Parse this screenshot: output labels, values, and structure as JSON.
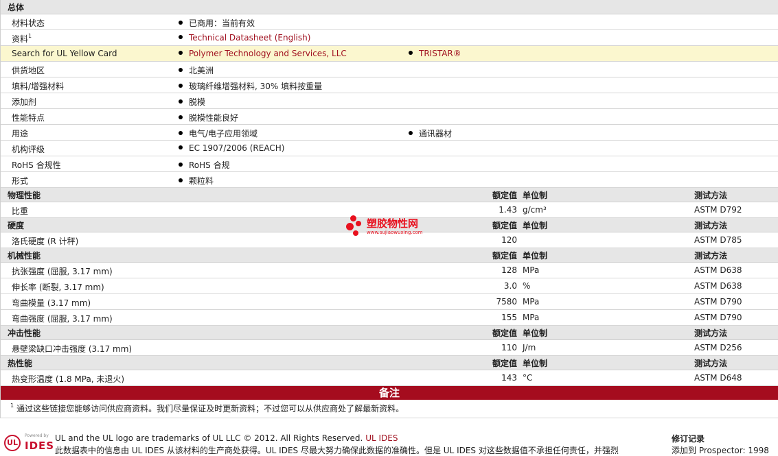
{
  "general": {
    "title": "总体",
    "rows": [
      {
        "label": "材料状态",
        "items": [
          "已商用：当前有效"
        ]
      },
      {
        "label": "资料",
        "sup": "1",
        "items": [
          "Technical Datasheet (English)"
        ],
        "link": true
      },
      {
        "label": "Search for UL Yellow Card",
        "items": [
          "Polymer Technology and Services, LLC",
          "TRISTAR®"
        ],
        "link": true,
        "highlight": true
      },
      {
        "label": "供货地区",
        "items": [
          "北美洲"
        ]
      },
      {
        "label": "填料/增强材料",
        "items": [
          "玻璃纤维增强材料, 30% 填料按重量"
        ]
      },
      {
        "label": "添加剂",
        "items": [
          "脱模"
        ]
      },
      {
        "label": "性能特点",
        "items": [
          "脱模性能良好"
        ]
      },
      {
        "label": "用途",
        "items": [
          "电气/电子应用领域",
          "通讯器材"
        ]
      },
      {
        "label": "机构评级",
        "items": [
          "EC 1907/2006 (REACH)"
        ]
      },
      {
        "label": "RoHS 合规性",
        "items": [
          "RoHS 合规"
        ]
      },
      {
        "label": "形式",
        "items": [
          "颗粒料"
        ]
      }
    ]
  },
  "col_headers": {
    "value": "额定值",
    "unit": "单位制",
    "method": "测试方法"
  },
  "sections": [
    {
      "title": "物理性能",
      "rows": [
        {
          "label": "比重",
          "value": "1.43",
          "unit": "g/cm³",
          "method": "ASTM D792"
        }
      ]
    },
    {
      "title": "硬度",
      "rows": [
        {
          "label": "洛氏硬度 (R 计秤)",
          "value": "120",
          "unit": "",
          "method": "ASTM D785"
        }
      ]
    },
    {
      "title": "机械性能",
      "rows": [
        {
          "label": "抗张强度 (屈服, 3.17 mm)",
          "value": "128",
          "unit": "MPa",
          "method": "ASTM D638"
        },
        {
          "label": "伸长率 (断裂, 3.17 mm)",
          "value": "3.0",
          "unit": "%",
          "method": "ASTM D638"
        },
        {
          "label": "弯曲模量 (3.17 mm)",
          "value": "7580",
          "unit": "MPa",
          "method": "ASTM D790"
        },
        {
          "label": "弯曲强度 (屈服, 3.17 mm)",
          "value": "155",
          "unit": "MPa",
          "method": "ASTM D790"
        }
      ]
    },
    {
      "title": "冲击性能",
      "rows": [
        {
          "label": "悬壁梁缺口冲击强度 (3.17 mm)",
          "value": "110",
          "unit": "J/m",
          "method": "ASTM D256"
        }
      ]
    },
    {
      "title": "热性能",
      "rows": [
        {
          "label": "热变形温度 (1.8 MPa, 未退火)",
          "value": "143",
          "unit": "°C",
          "method": "ASTM D648"
        }
      ]
    }
  ],
  "notes": {
    "title": "备注",
    "sup": "1",
    "text": "通过这些链接您能够访问供应商资料。我们尽量保证及时更新资料；不过您可以从供应商处了解最新资料。"
  },
  "watermark": {
    "cn": "塑胶物性网",
    "en": "www.sujiaowuxing.com"
  },
  "footer": {
    "logo_text": "UL",
    "powered_by": "Powered by",
    "ides_logo": "IDES",
    "copyright": "UL and the UL logo are trademarks of UL LLC © 2012. All Rights Reserved.",
    "copyright_link": "UL IDES",
    "disclaimer": "此数据表中的信息由 UL IDES 从该材料的生产商处获得。UL IDES 尽最大努力确保此数据的准确性。但是 UL IDES 对这些数据值不承担任何责任，并强烈",
    "revision_title": "修订记录",
    "revision_line": "添加到 Prospector:   1998"
  },
  "colors": {
    "accent_red": "#a50c1e",
    "link": "#a0101f",
    "highlight": "#fbf7cf"
  }
}
